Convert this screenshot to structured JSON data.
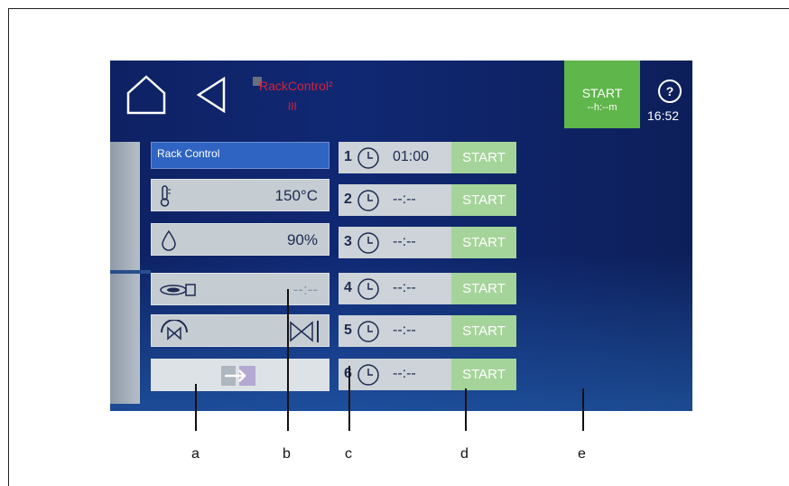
{
  "header": {
    "logo_text": "RackControl²",
    "start_button": {
      "label": "START",
      "time": "--h:--m"
    },
    "help": "?",
    "time": "16:52"
  },
  "rack_control": {
    "title": "Rack Control",
    "temperature": "150°C",
    "humidity": "90%",
    "time": "--:--"
  },
  "timers": [
    {
      "num": "1",
      "time": "01:00",
      "action": "START"
    },
    {
      "num": "2",
      "time": "--:--",
      "action": "START"
    },
    {
      "num": "3",
      "time": "--:--",
      "action": "START"
    },
    {
      "num": "4",
      "time": "--:--",
      "action": "START"
    },
    {
      "num": "5",
      "time": "--:--",
      "action": "START"
    },
    {
      "num": "6",
      "time": "--:--",
      "action": "START"
    }
  ],
  "callouts": [
    "a",
    "b",
    "c",
    "d",
    "e"
  ],
  "colors": {
    "accent_green": "#5fb64a",
    "screen_blue": "#102873",
    "title_blue": "#2f64c2"
  }
}
